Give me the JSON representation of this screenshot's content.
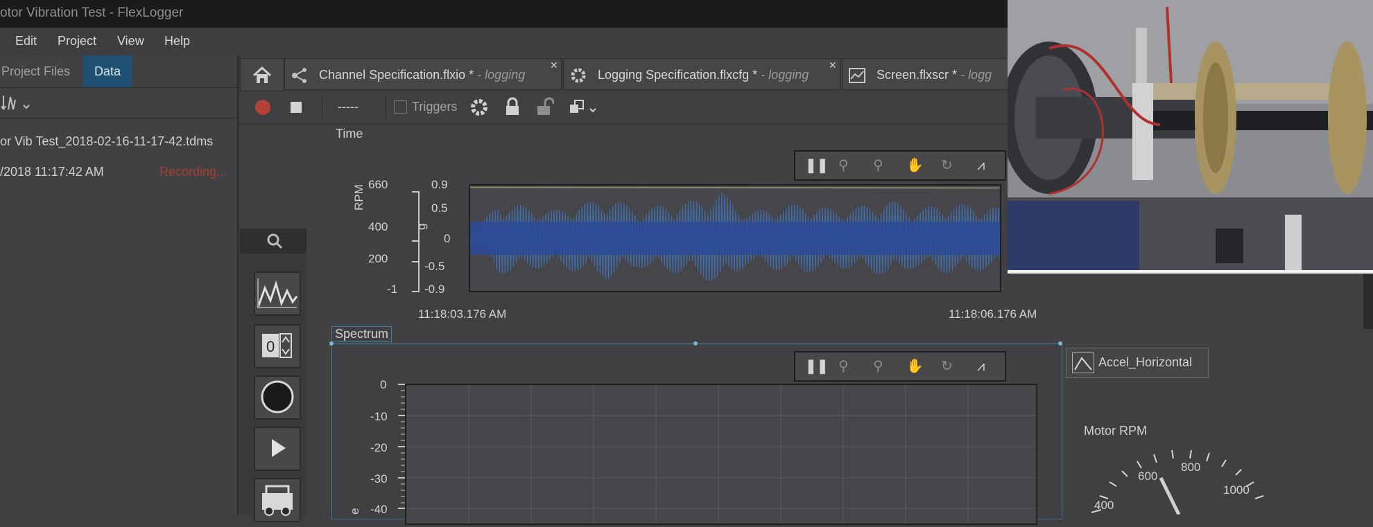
{
  "window": {
    "title": "otor Vibration Test - FlexLogger"
  },
  "menu": {
    "items": [
      "Edit",
      "Project",
      "View",
      "Help"
    ]
  },
  "left_panel": {
    "tabs": [
      "Project Files",
      "Data"
    ],
    "file_name": "or Vib Test_2018-02-16-11-17-42.tdms",
    "log_time": "/2018 11:17:42 AM",
    "status": "Recording..."
  },
  "doc_tabs": [
    {
      "name": "Channel Specification.flxio *",
      "suffix": "- logging"
    },
    {
      "name": "Logging Specification.flxcfg *",
      "suffix": "- logging"
    },
    {
      "name": "Screen.flxscr *",
      "suffix": "- logg"
    }
  ],
  "toolbar": {
    "counter": "-----",
    "triggers_label": "Triggers"
  },
  "time_graph": {
    "label": "Time",
    "rpm_axis_label": "RPM",
    "g_axis_label": "g",
    "rpm_ticks": [
      "660",
      "400",
      "200",
      "-1"
    ],
    "g_ticks": [
      "0.9",
      "0.5",
      "0",
      "-0.5",
      "-0.9"
    ],
    "x_start": "11:18:03.176 AM",
    "x_end": "11:18:06.176 AM"
  },
  "spectrum_graph": {
    "label": "Spectrum",
    "y_ticks": [
      "0",
      "-10",
      "-20",
      "-30",
      "-40"
    ],
    "y_axis_partial": "e",
    "legend": "Accel_Horizontal"
  },
  "gauge": {
    "title": "Motor RPM",
    "ticks": [
      "400",
      "600",
      "800",
      "1000"
    ],
    "value_rpm": 660
  },
  "colors": {
    "selected_tab": "#1f4f73",
    "recording": "#a8402e",
    "signal": "#2a4a9a",
    "signal_light": "#3f6fb0",
    "rpm_trace": "#8a8a6a"
  },
  "chart_data": {
    "type": "line",
    "series": [
      {
        "name": "g",
        "values": [
          0,
          0.62,
          -0.55,
          0.48,
          -0.6,
          0.7,
          -0.5,
          0.58,
          -0.65,
          0.8,
          -0.45,
          0.55,
          -0.6,
          0.5,
          -0.55,
          0.66,
          -0.5,
          0.6,
          -0.58,
          0.52
        ]
      }
    ],
    "ylim": [
      -0.9,
      0.9
    ],
    "xlabel": "",
    "ylabel": "g"
  }
}
